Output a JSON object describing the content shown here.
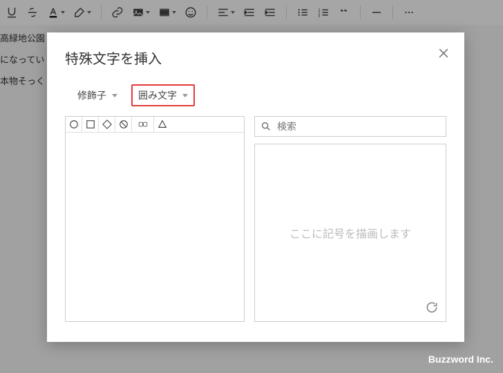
{
  "toolbar": {
    "icons": [
      "underline",
      "strikethrough",
      "text-color",
      "highlight",
      "link",
      "image",
      "video",
      "emoji",
      "align",
      "indent-decrease",
      "indent-increase",
      "bullet-list",
      "numbered-list",
      "quote",
      "horizontal-rule",
      "more"
    ]
  },
  "document": {
    "line1": "高緑地公園",
    "line2": "になってい",
    "line3": "本物そっく"
  },
  "dialog": {
    "title": "特殊文字を挿入",
    "close_label": "閉じる",
    "dropdown_category": "修飾子",
    "dropdown_subcategory": "囲み文字",
    "chars_row": [
      "circle",
      "square",
      "diamond",
      "prohibit",
      "keycap",
      "triangle"
    ],
    "search_placeholder": "検索",
    "draw_hint": "ここに記号を描画します",
    "reset_label": "リセット"
  },
  "watermark": "Buzzword Inc."
}
